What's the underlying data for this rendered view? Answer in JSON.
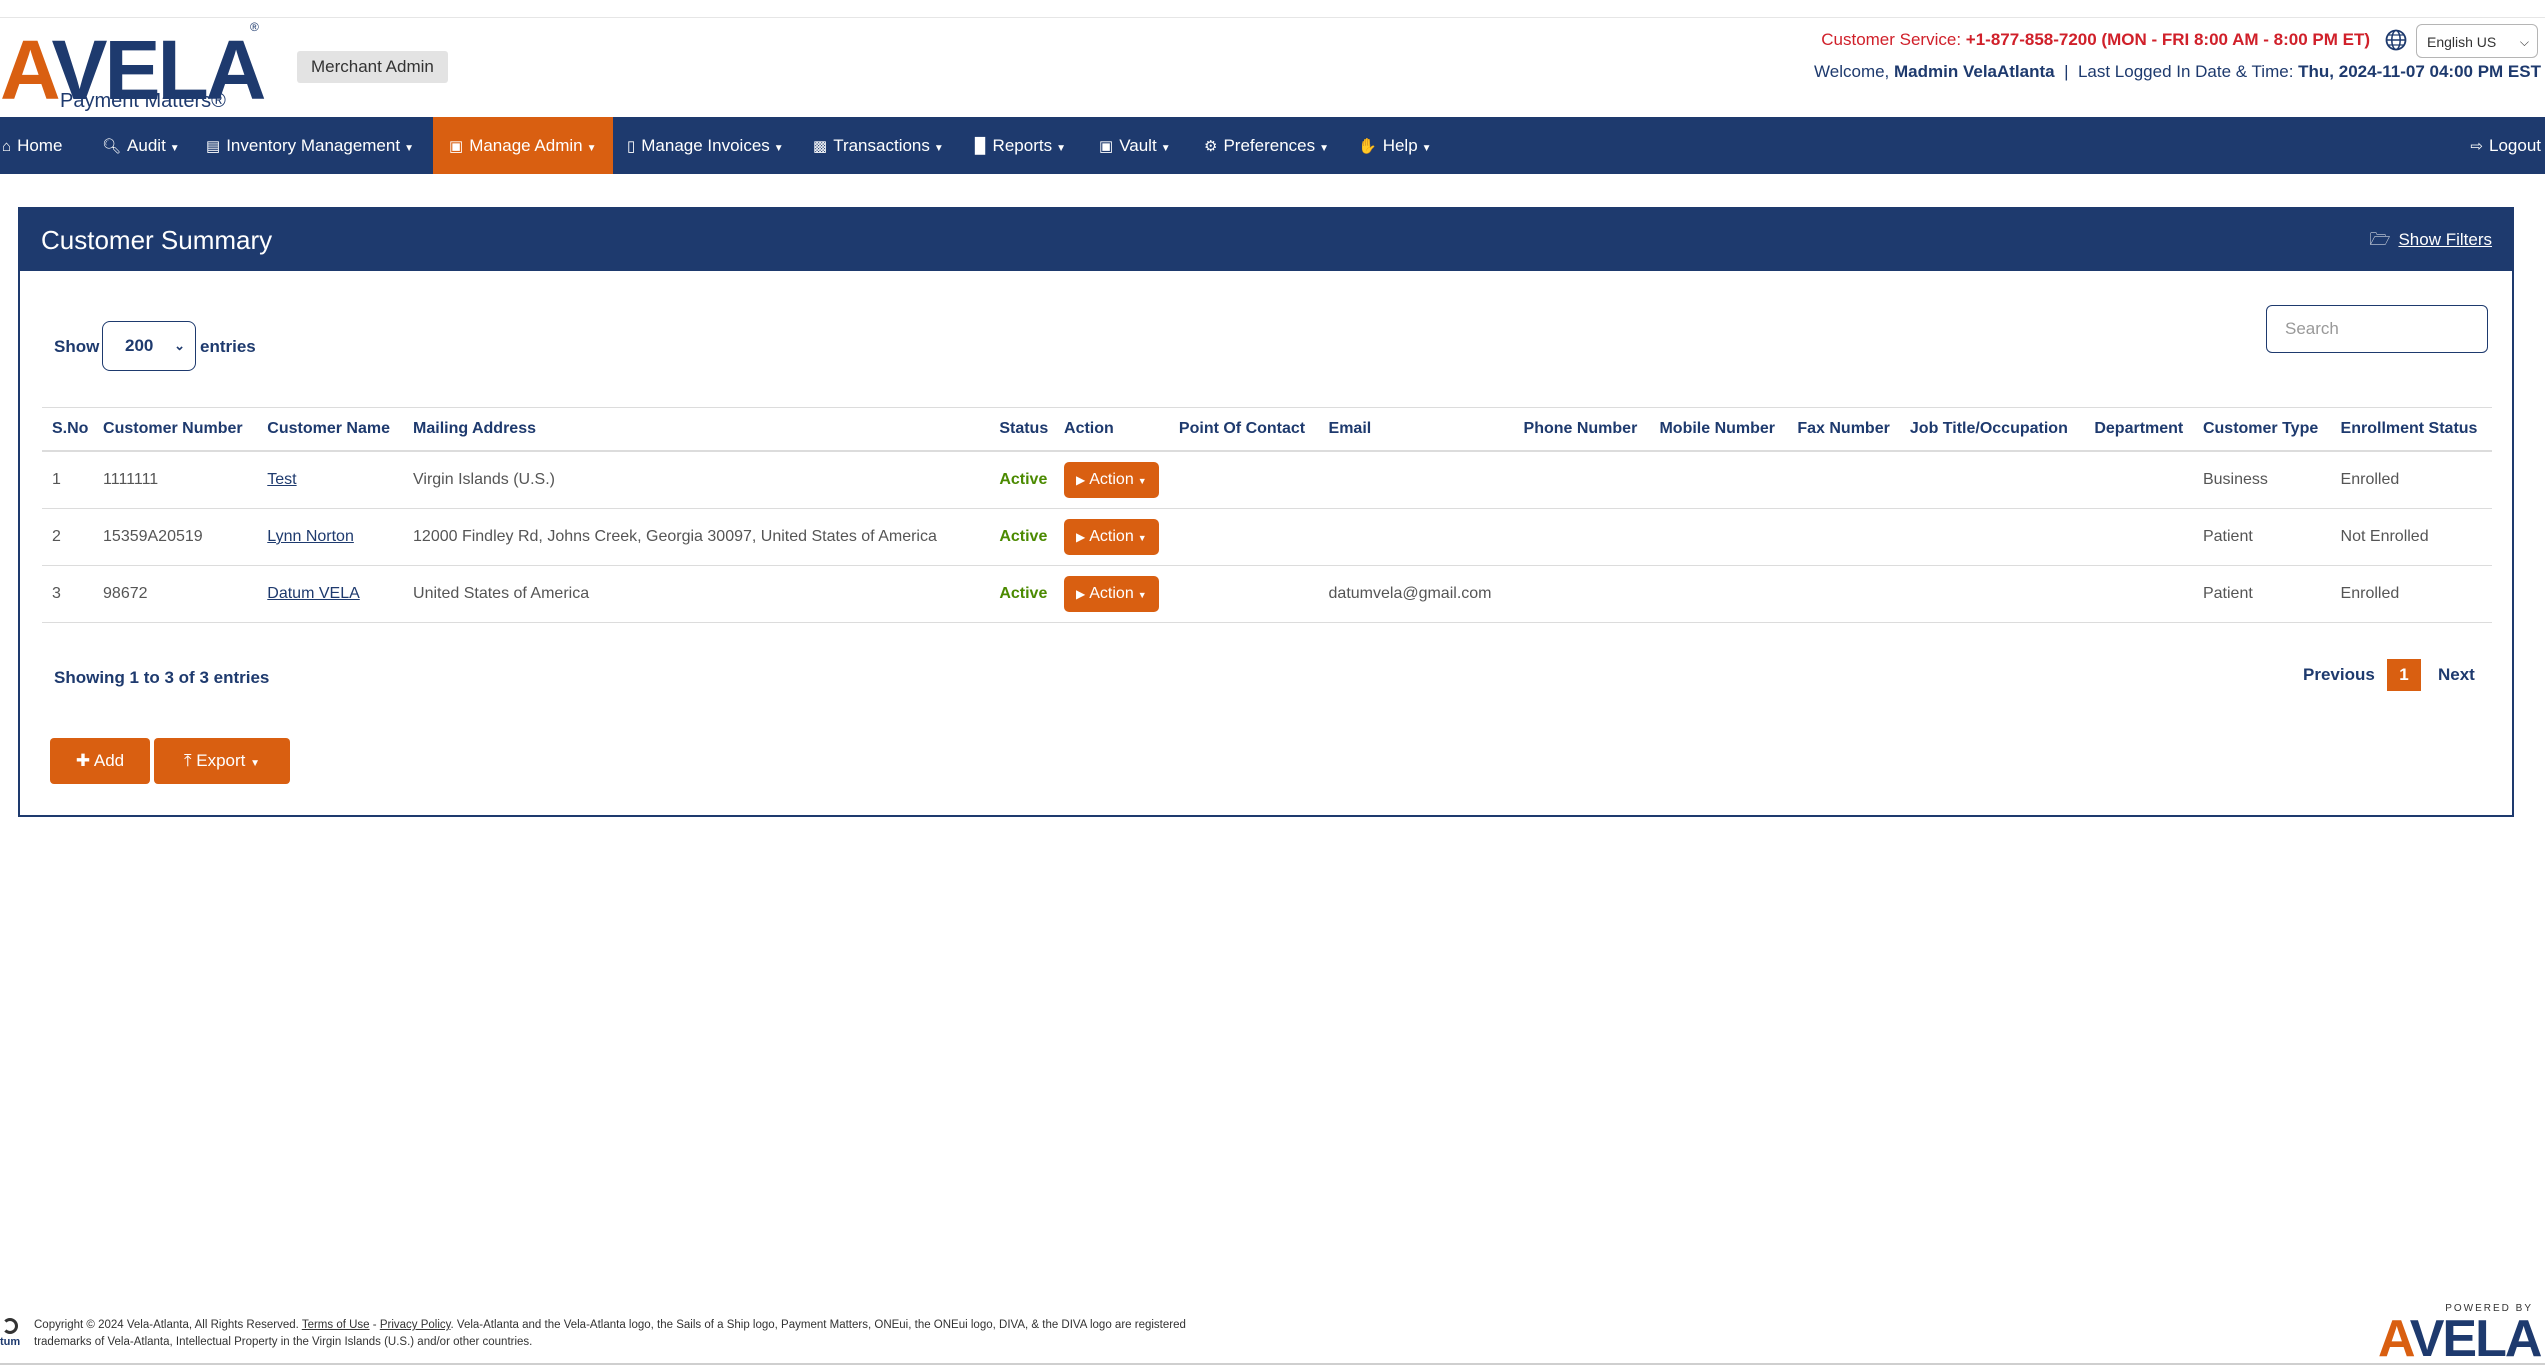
{
  "brand": {
    "logo_text_a": "A",
    "logo_text_rest": "VELA",
    "reg": "®",
    "tagline": "Payment Matters®"
  },
  "header": {
    "role_badge": "Merchant Admin",
    "cs_label": "Customer Service:",
    "cs_value": "+1-877-858-7200 (MON - FRI 8:00 AM - 8:00 PM ET)",
    "language": "English US",
    "welcome_label": "Welcome,",
    "welcome_user": "Madmin VelaAtlanta",
    "separator": "|",
    "last_login_label": "Last Logged In Date & Time:",
    "last_login_value": "Thu, 2024-11-07 04:00 PM EST"
  },
  "nav": {
    "home": "Home",
    "audit": "Audit",
    "inventory": "Inventory Management",
    "manage_admin": "Manage Admin",
    "manage_invoices": "Manage Invoices",
    "transactions": "Transactions",
    "reports": "Reports",
    "vault": "Vault",
    "preferences": "Preferences",
    "help": "Help",
    "logout": "Logout"
  },
  "panel": {
    "title": "Customer Summary",
    "show_filters": "Show Filters",
    "show_label": "Show",
    "entries_value": "200",
    "entries_label": "entries",
    "search_placeholder": "Search",
    "showing_text": "Showing 1 to 3 of 3 entries",
    "pager": {
      "previous": "Previous",
      "current": "1",
      "next": "Next"
    },
    "add_label": "Add",
    "export_label": "Export"
  },
  "table": {
    "columns": [
      "S.No",
      "Customer Number",
      "Customer Name",
      "Mailing Address",
      "Status",
      "Action",
      "Point Of Contact",
      "Email",
      "Phone Number",
      "Mobile Number",
      "Fax Number",
      "Job Title/Occupation",
      "Department",
      "Customer Type",
      "Enrollment Status"
    ],
    "rows": [
      {
        "sno": "1",
        "number": "1111111",
        "name": "Test",
        "address": "Virgin Islands (U.S.)",
        "status": "Active",
        "action": "Action",
        "contact": "",
        "email": "",
        "phone": "",
        "mobile": "",
        "fax": "",
        "job": "",
        "department": "",
        "type": "Business",
        "enrollment": "Enrolled"
      },
      {
        "sno": "2",
        "number": "15359A20519",
        "name": "Lynn Norton",
        "address": "12000 Findley Rd, Johns Creek, Georgia 30097, United States of America",
        "status": "Active",
        "action": "Action",
        "contact": "",
        "email": "",
        "phone": "",
        "mobile": "",
        "fax": "",
        "job": "",
        "department": "",
        "type": "Patient",
        "enrollment": "Not Enrolled"
      },
      {
        "sno": "3",
        "number": "98672",
        "name": "Datum VELA",
        "address": "United States of America",
        "status": "Active",
        "action": "Action",
        "contact": "",
        "email": "datumvela@gmail.com",
        "phone": "",
        "mobile": "",
        "fax": "",
        "job": "",
        "department": "",
        "type": "Patient",
        "enrollment": "Enrolled"
      }
    ]
  },
  "footer": {
    "copyright": "Copyright © 2024 Vela-Atlanta, All Rights Reserved.",
    "terms": "Terms of Use",
    "dash": "-",
    "privacy": "Privacy Policy",
    "trademark": ". Vela-Atlanta and the Vela-Atlanta logo, the Sails of a Ship logo, Payment Matters, ONEui, the ONEui logo, DIVA, & the DIVA logo are registered trademarks of Vela-Atlanta, Intellectual Property in the Virgin Islands (U.S.) and/or other countries.",
    "side_icon_text": "tum",
    "powered_by": "POWERED BY",
    "footer_logo_a": "A",
    "footer_logo_rest": "VELA"
  },
  "colors": {
    "navy": "#1e3a6e",
    "orange": "#d95f11",
    "active_green": "#4b8a00",
    "cs_red": "#d0202a"
  },
  "icons": [
    "home-icon",
    "search-icon",
    "inventory-icon",
    "admin-icon",
    "invoice-icon",
    "transactions-icon",
    "reports-icon",
    "vault-icon",
    "gear-icon",
    "help-icon",
    "logout-icon",
    "folder-icon",
    "globe-icon",
    "plus-icon",
    "export-icon",
    "play-icon"
  ]
}
